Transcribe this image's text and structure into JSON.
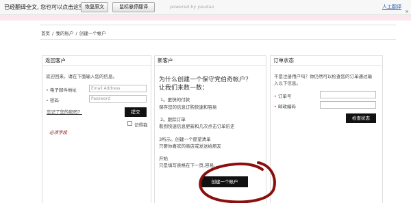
{
  "translation_bar": {
    "message": "已经翻译全文, 您也可以点击这里",
    "show_original_label": "恢复原文",
    "hover_translate_label": "鼠标悬停翻译",
    "powered": "powered by youdao",
    "manual_translate_label": "人工翻译",
    "close_glyph": "×"
  },
  "breadcrumb": [
    "首页",
    "/",
    "我的账户",
    "/",
    "创建一个帐户"
  ],
  "returning": {
    "title": "返回客户",
    "intro": "欢迎回来。请在下面输入您的信息。",
    "email_label": "电子邮件地址",
    "email_placeholder": "Email Address",
    "password_label": "密码",
    "password_placeholder": "Password",
    "forgot_label": "忘记了您的密码？",
    "submit_label": "提交",
    "remember_label": "记得我",
    "required_note": "必须字段"
  },
  "new_customer": {
    "title": "新客户",
    "heading_line1": "为什么创建一个保守党伯奇帐户？",
    "heading_line2": "让我们来数一数：",
    "items": [
      {
        "title": "1。更快的付款",
        "desc": "保存您的信息订购快速和容易"
      },
      {
        "title": "2。跟踪订单",
        "desc": "看到快速信息更新和几次点击订单历史"
      },
      {
        "title": "3所示。创建一个愿望清单",
        "desc": "只要你喜欢的商店或发送给朋友"
      },
      {
        "title": "开始",
        "desc": "只是填写表格在下一页,容易…"
      }
    ],
    "create_label": "创建一个帐户"
  },
  "order_status": {
    "title": "订单状态",
    "intro_line1": "不是注册用户吗？你仍然可以检查您的订单通过输",
    "intro_line2": "入以下信息。",
    "order_label": "订单号",
    "zip_label": "邮政编码",
    "check_label": "检查状态"
  },
  "colors": {
    "accent_red": "#8b0f0f",
    "forgot_link": "#d98324",
    "button_black": "#111111"
  }
}
